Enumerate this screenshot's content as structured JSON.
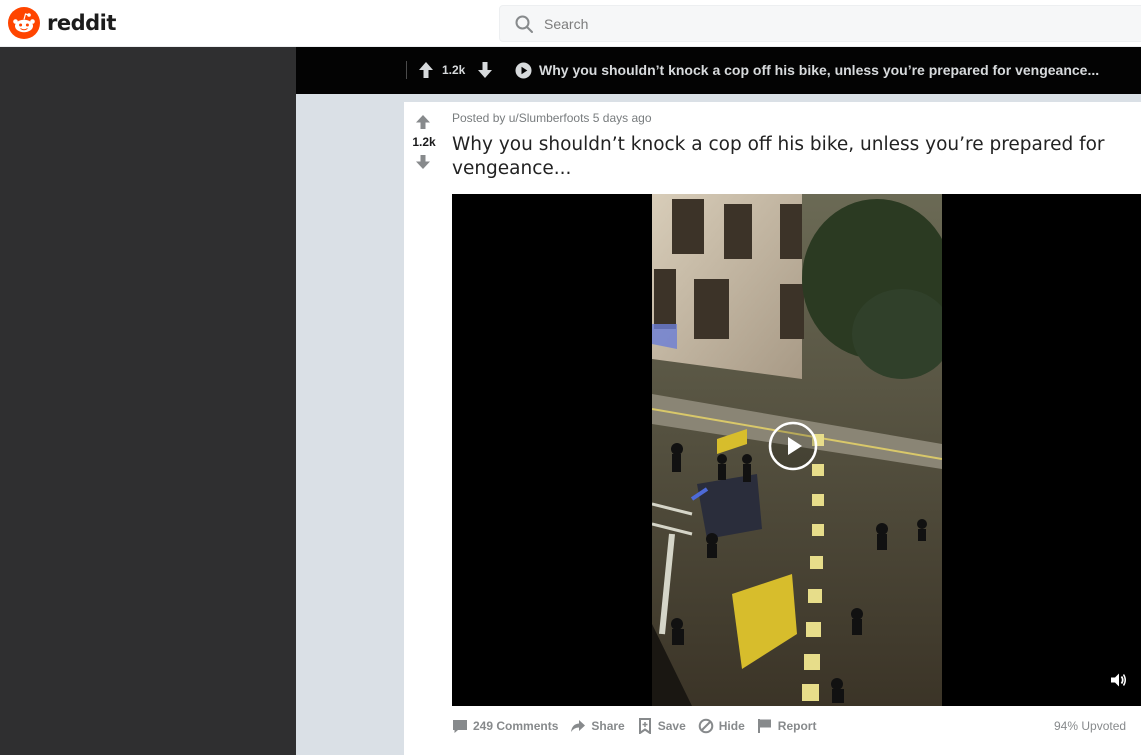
{
  "header": {
    "logo_text": "reddit",
    "search_placeholder": "Search"
  },
  "post_bar": {
    "score": "1.2k",
    "title": "Why you shouldn’t knock a cop off his bike, unless you’re prepared for vengeance..."
  },
  "post": {
    "posted_by_prefix": "Posted by",
    "username": "u/Slumberfoots",
    "time_ago": "5 days ago",
    "score": "1.2k",
    "title": "Why you shouldn’t knock a cop off his bike, unless you’re prepared for vengeance..."
  },
  "actions": {
    "comments": "249 Comments",
    "share": "Share",
    "save": "Save",
    "hide": "Hide",
    "report": "Report"
  },
  "upvoted": "94% Upvoted",
  "colors": {
    "brand": "#ff4500",
    "header_bg": "#ffffff",
    "bar_bg": "#030303",
    "page_bg": "#dae0e6",
    "backdrop": "#2f2f30",
    "meta_text": "#878a8c"
  },
  "icons": {
    "logo": "reddit-snoo-icon",
    "search": "search-icon",
    "upvote": "upvote-arrow-icon",
    "downvote": "downvote-arrow-icon",
    "video": "play-circle-icon",
    "volume": "volume-icon",
    "comments": "comment-icon",
    "share": "share-icon",
    "save": "bookmark-icon",
    "hide": "hide-icon",
    "report": "flag-icon"
  }
}
